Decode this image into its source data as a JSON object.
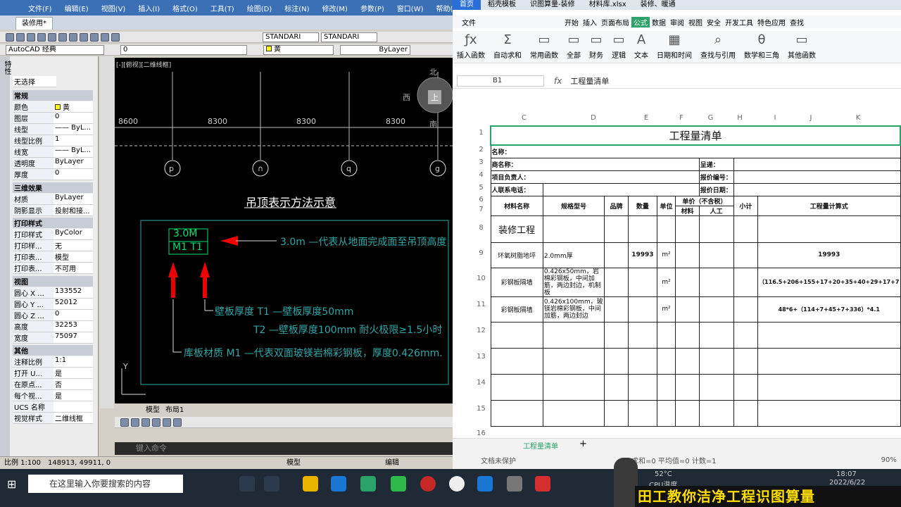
{
  "cad": {
    "menu": [
      "文件(F)",
      "编辑(E)",
      "视图(V)",
      "插入(I)",
      "格式(O)",
      "工具(T)",
      "绘图(D)",
      "标注(N)",
      "修改(M)",
      "参数(P)",
      "窗口(W)",
      "帮助(H)"
    ],
    "doc_tab": "装修用*",
    "style1": "STANDARI",
    "style2": "STANDARI",
    "workspace": "AutoCAD 经典",
    "layer": "0",
    "color": "黄",
    "linetype": "ByLayer",
    "layout_tabs": [
      "模型",
      "布局1"
    ],
    "command_placeholder": "键入命令",
    "status": {
      "scale": "比例 1:100",
      "coords": "148913, 49911, 0",
      "model": "模型",
      "edit": "编辑"
    }
  },
  "props": {
    "title": "特性",
    "selection": "无选择",
    "sec_general": "常规",
    "rows": [
      {
        "k": "颜色",
        "v": "黄"
      },
      {
        "k": "图层",
        "v": "0"
      },
      {
        "k": "线型",
        "v": "—— ByL..."
      },
      {
        "k": "线型比例",
        "v": "1"
      },
      {
        "k": "线宽",
        "v": "—— ByL..."
      },
      {
        "k": "透明度",
        "v": "ByLayer"
      },
      {
        "k": "厚度",
        "v": "0"
      }
    ],
    "sec_3d": "三维效果",
    "rows3d": [
      {
        "k": "材质",
        "v": "ByLayer"
      },
      {
        "k": "阴影显示",
        "v": "投射和接..."
      }
    ],
    "sec_plot": "打印样式",
    "rowsplot": [
      {
        "k": "打印样式",
        "v": "ByColor"
      },
      {
        "k": "打印样...",
        "v": "无"
      },
      {
        "k": "打印表...",
        "v": "模型"
      },
      {
        "k": "打印表...",
        "v": "不可用"
      }
    ],
    "sec_view": "视图",
    "rowsview": [
      {
        "k": "圆心 X ...",
        "v": "133552"
      },
      {
        "k": "圆心 Y ...",
        "v": "52012"
      },
      {
        "k": "圆心 Z ...",
        "v": "0"
      },
      {
        "k": "高度",
        "v": "32253"
      },
      {
        "k": "宽度",
        "v": "75097"
      }
    ],
    "sec_misc": "其他",
    "rowsmisc": [
      {
        "k": "注释比例",
        "v": "1:1"
      },
      {
        "k": "打开 U...",
        "v": "是"
      },
      {
        "k": "在原点...",
        "v": "否"
      },
      {
        "k": "每个视...",
        "v": "是"
      },
      {
        "k": "UCS 名称",
        "v": ""
      },
      {
        "k": "视觉样式",
        "v": "二维线框"
      }
    ]
  },
  "drawing": {
    "viewport": "[-][俯视][二维线框]",
    "dims": [
      "8600",
      "8300",
      "8300",
      "8300"
    ],
    "axes": [
      "p",
      "∩",
      "q",
      "g"
    ],
    "viewcube": {
      "north": "北",
      "west": "西",
      "south": "南",
      "top": "上"
    },
    "title": "吊顶表示方法示意",
    "mark_height": "3.0M",
    "mark_mat": "M1 T1",
    "notes": [
      "3.0m —代表从地面完成面至吊顶高度",
      "壁板厚度 T1 —壁板厚度50mm",
      "T2 —壁板厚度100mm 耐火极限≥1.5小时",
      "库板材质 M1 —代表双面玻镁岩棉彩钢板，厚度0.426mm."
    ],
    "ucs_y": "Y"
  },
  "ss": {
    "wtabs": [
      "首页",
      "稻壳模板",
      "识图算量-装修",
      "材料库.xlsx",
      "装修、暖通"
    ],
    "ribtabs": [
      "文件",
      "开始",
      "插入",
      "页面布局",
      "公式",
      "数据",
      "审阅",
      "视图",
      "安全",
      "开发工具",
      "特色应用",
      "查找"
    ],
    "ribbon": [
      "插入函数",
      "自动求和",
      "常用函数",
      "全部",
      "财务",
      "逻辑",
      "文本",
      "日期和时间",
      "查找与引用",
      "数学和三角",
      "其他函数"
    ],
    "namebox": "B1",
    "formula": "工程量清单",
    "cols": [
      "C",
      "D",
      "E",
      "F",
      "G",
      "H",
      "I",
      "J",
      "K"
    ],
    "rows": [
      "1",
      "2",
      "3",
      "4",
      "5",
      "6",
      "7",
      "8",
      "9",
      "10",
      "11",
      "12",
      "13",
      "14",
      "15",
      "16"
    ],
    "sheet_tab": "工程量清单",
    "status": {
      "protect": "文档未保护",
      "calc": "求和=0  平均值=0  计数=1",
      "zoom": "90%"
    }
  },
  "sheet": {
    "title": "工程量清单",
    "name_label": "名称：",
    "client_label": "商名称：",
    "submit_label": "呈递：",
    "pm_label": "项目负责人：",
    "quote_no_label": "报价编号：",
    "phone_label": "人联系电话：",
    "quote_date_label": "报价日期：",
    "headers": [
      "材料名称",
      "规格型号",
      "品牌",
      "数量",
      "单位",
      "单价（不含税）",
      "小计",
      "工程量计算式",
      "材料",
      "人工"
    ],
    "section": "装修工程",
    "rows": [
      {
        "name": "环氧树脂地坪",
        "spec": "2.0mm厚",
        "qty": "19993",
        "unit": "m²",
        "formula": "19993"
      },
      {
        "name": "彩钢板隔墙",
        "spec": "0.426x50mm，岩棉彩钢板，中间加筋，两边封边，机制板",
        "unit": "m²",
        "formula": "（116.5+206+155+17+20+35+40+29+17+7"
      },
      {
        "name": "彩钢板隔墙",
        "spec": "0.426x100mm，玻镁岩棉彩钢板，中间加筋，两边封边",
        "unit": "m²",
        "formula": "48*6+（114+7+45+7+336）*4.1"
      }
    ]
  },
  "taskbar": {
    "search": "在这里输入你要搜索的内容",
    "temp": "52°C",
    "temp_label": "CPU温度",
    "time": "18:07",
    "date": "2022/6/22"
  },
  "banner": "田工教你洁净工程识图算量"
}
